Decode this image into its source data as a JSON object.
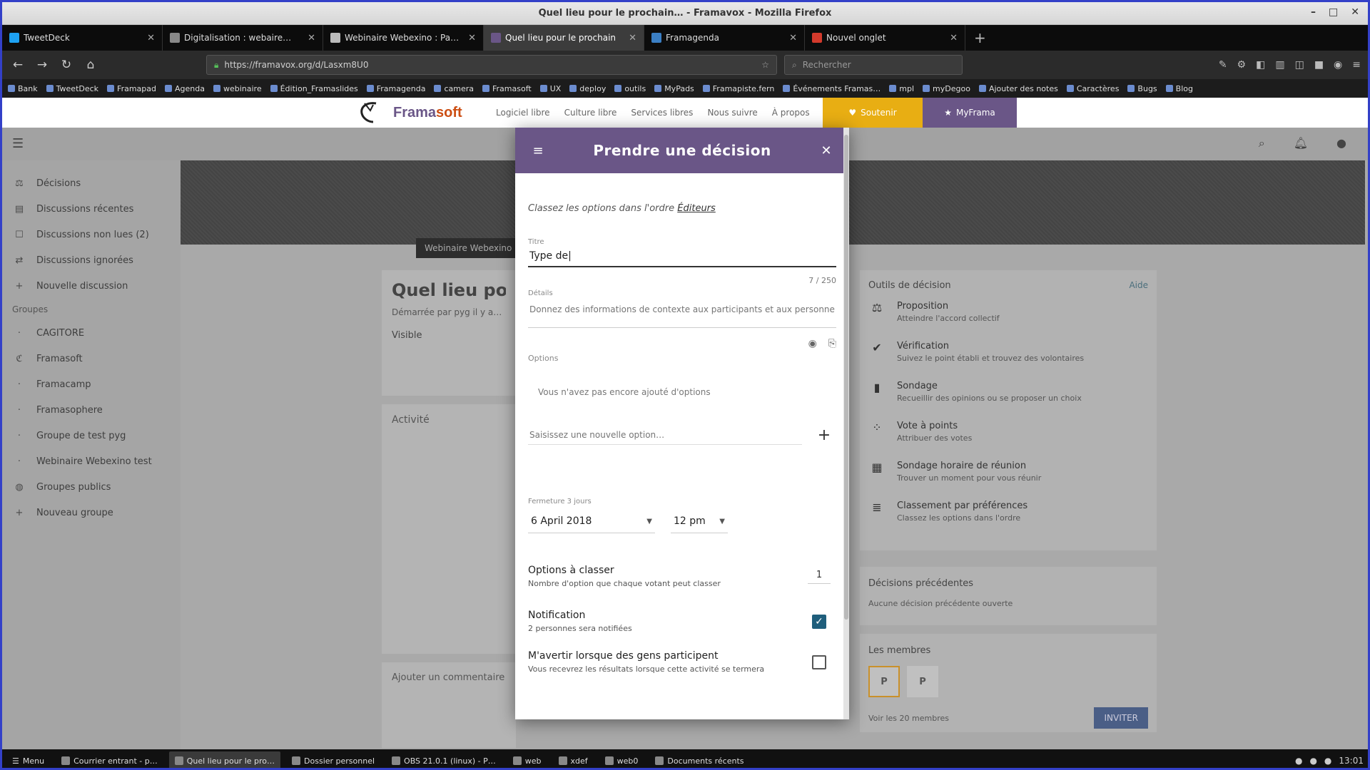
{
  "window": {
    "title": "Quel lieu pour le prochain… - Framavox - Mozilla Firefox"
  },
  "tabs": [
    {
      "label": "TweetDeck",
      "color": "#1da1f2"
    },
    {
      "label": "Digitalisation : webaire…",
      "color": "#888888"
    },
    {
      "label": "Webinaire Webexino : Pages",
      "color": "#bbbbbb"
    },
    {
      "label": "Quel lieu pour le prochain",
      "color": "#6a5687"
    },
    {
      "label": "Framagenda",
      "color": "#3b7fc4"
    },
    {
      "label": "Nouvel onglet",
      "color": "#d33a2c"
    }
  ],
  "nav": {
    "url": "https://framavox.org/d/Lasxm8U0",
    "search_placeholder": "Rechercher"
  },
  "bookmarks": [
    "Bank",
    "TweetDeck",
    "Framapad",
    "Agenda",
    "webinaire",
    "Édition_Framaslides",
    "Framagenda",
    "camera",
    "Framasoft",
    "UX",
    "deploy",
    "outils",
    "MyPads",
    "Framapiste.fern",
    "Événements Framas…",
    "mpl",
    "myDegoo",
    "Ajouter des notes",
    "Caractères",
    "Bugs",
    "Blog"
  ],
  "framasoft": {
    "name_a": "Frama",
    "name_b": "soft",
    "menu": [
      "Logiciel libre",
      "Culture libre",
      "Services libres",
      "Nous suivre",
      "À propos"
    ],
    "support_label": "Soutenir",
    "mypads_label": "MyFrama"
  },
  "app": {
    "sidebar_items": [
      {
        "icon": "decisions-icon",
        "glyph": "⚖",
        "label": "Décisions"
      },
      {
        "icon": "chat-icon",
        "glyph": "▤",
        "label": "Discussions récentes"
      },
      {
        "icon": "unread-icon",
        "glyph": "☐",
        "label": "Discussions non lues (2)"
      },
      {
        "icon": "muted-icon",
        "glyph": "⇄",
        "label": "Discussions ignorées"
      },
      {
        "icon": "plus-icon",
        "glyph": "+",
        "label": "Nouvelle discussion"
      }
    ],
    "groups_heading": "Groupes",
    "group_items": [
      {
        "icon": "group-icon",
        "glyph": "·",
        "label": "CAGITORE"
      },
      {
        "icon": "framasoft-icon",
        "glyph": "ℭ",
        "label": "Framasoft"
      },
      {
        "icon": "group-icon",
        "glyph": "·",
        "label": "Framacamp"
      },
      {
        "icon": "group-icon",
        "glyph": "·",
        "label": "Framasophere"
      },
      {
        "icon": "group-icon",
        "glyph": "·",
        "label": "Groupe de test pyg"
      },
      {
        "icon": "group-icon",
        "glyph": "·",
        "label": "Webinaire Webexino test"
      },
      {
        "icon": "globe-icon",
        "glyph": "◍",
        "label": "Groupes publics"
      },
      {
        "icon": "plus-icon",
        "glyph": "+",
        "label": "Nouveau groupe"
      }
    ],
    "banner_label": "Webinaire Webexino",
    "thread": {
      "title": "Quel lieu pour le…",
      "meta": "Démarrée par pyg il y a…",
      "visibility": "Visible"
    },
    "activity": {
      "heading": "Activité"
    },
    "comment": {
      "heading": "Ajouter un commentaire"
    },
    "decision_types": {
      "heading": "Outils de décision",
      "link": "Aide",
      "items": [
        {
          "icon": "proposal-icon",
          "glyph": "⚖",
          "title": "Proposition",
          "sub": "Atteindre l'accord collectif"
        },
        {
          "icon": "check-icon",
          "glyph": "✔",
          "title": "Vérification",
          "sub": "Suivez le point établi et trouvez des volontaires"
        },
        {
          "icon": "poll-icon",
          "glyph": "▮",
          "title": "Sondage",
          "sub": "Recueillir des opinions ou se proposer un choix"
        },
        {
          "icon": "dots-icon",
          "glyph": "⁘",
          "title": "Vote à points",
          "sub": "Attribuer des votes"
        },
        {
          "icon": "calendar-icon",
          "glyph": "▦",
          "title": "Sondage horaire de réunion",
          "sub": "Trouver un moment pour vous réunir"
        },
        {
          "icon": "ranking-icon",
          "glyph": "≣",
          "title": "Classement par préférences",
          "sub": "Classez les options dans l'ordre"
        }
      ]
    },
    "previous": {
      "heading": "Décisions précédentes",
      "sub": "Aucune décision précédente ouverte"
    },
    "members": {
      "heading": "Les membres",
      "button": "INVITER",
      "footer": "Voir les 20 membres"
    }
  },
  "modal": {
    "title": "Prendre une décision",
    "hint_text": "Classez les options dans l'ordre",
    "hint_link": "Éditeurs",
    "title_label": "Titre",
    "title_value": "Type de|",
    "counter": "7 / 250",
    "details_label": "Détails",
    "details_placeholder": "Donnez des informations de contexte aux participants et aux personnes de référence",
    "options_label": "Options",
    "no_options": "Vous n'avez pas encore ajouté d'options",
    "add_option_placeholder": "Saisissez une nouvelle option…",
    "closing_label": "Fermeture 3 jours",
    "date_value": "6 April 2018",
    "time_value": "12 pm",
    "rank": {
      "title": "Options à classer",
      "sub": "Nombre d'option que chaque votant peut classer",
      "value": "1"
    },
    "notify": {
      "title": "Notification",
      "sub": "2 personnes sera notifiées",
      "checked": true
    },
    "alert": {
      "title": "M'avertir lorsque des gens participent",
      "sub": "Vous recevrez les résultats lorsque cette activité se termera",
      "checked": false
    }
  },
  "taskbar": {
    "menu_label": "Menu",
    "items": [
      "Courrier entrant - p…",
      "Quel lieu pour le pro…",
      "Dossier personnel",
      "OBS 21.0.1 (linux) - P…",
      "web",
      "xdef",
      "web0",
      "Documents récents"
    ],
    "clock": "13:01"
  }
}
